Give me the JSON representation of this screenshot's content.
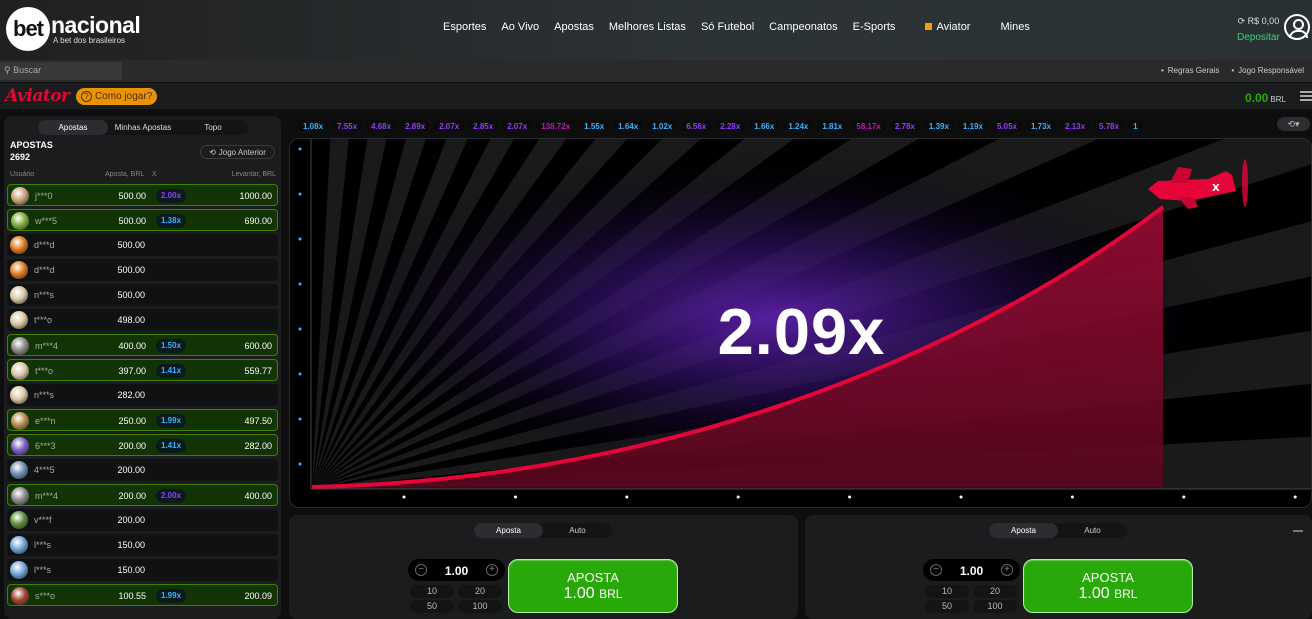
{
  "header": {
    "logo_bet": "bet",
    "logo_name": "nacional",
    "logo_tag": "A bet dos brasileiros",
    "nav": [
      "Esportes",
      "Ao Vivo",
      "Apostas",
      "Melhores Listas",
      "Só Futebol",
      "Campeonatos",
      "E-Sports",
      "Aviator",
      "Mines"
    ],
    "balance": "R$ 0,00",
    "deposit": "Depositar"
  },
  "subbar": {
    "search_placeholder": "Buscar",
    "links": [
      "Regras Gerais",
      "Jogo Responsável"
    ]
  },
  "aviator": {
    "logo": "Aviator",
    "howto": "Como jogar?",
    "balance": "0.00",
    "currency": "BRL"
  },
  "left": {
    "tabs": [
      "Apostas",
      "Minhas Apostas",
      "Topo"
    ],
    "title": "APOSTAS",
    "count": "2692",
    "prev_button": "Jogo Anterior",
    "columns": [
      "Usuário",
      "Aposta, BRL",
      "X",
      "Levantar, BRL"
    ],
    "rows": [
      {
        "user": "j***0",
        "bet": "500.00",
        "mult": "2.00x",
        "mult_color": "#913ef8",
        "cash": "1000.00",
        "win": true,
        "avatar": "#c8a27a"
      },
      {
        "user": "w***5",
        "bet": "500.00",
        "mult": "1.38x",
        "mult_color": "#34b4ff",
        "cash": "690.00",
        "win": true,
        "avatar": "#7fae3e"
      },
      {
        "user": "d***d",
        "bet": "500.00",
        "mult": "",
        "mult_color": "",
        "cash": "",
        "win": false,
        "avatar": "#e07a1f"
      },
      {
        "user": "d***d",
        "bet": "500.00",
        "mult": "",
        "mult_color": "",
        "cash": "",
        "win": false,
        "avatar": "#e07a1f"
      },
      {
        "user": "n***s",
        "bet": "500.00",
        "mult": "",
        "mult_color": "",
        "cash": "",
        "win": false,
        "avatar": "#d9c7a4"
      },
      {
        "user": "t***o",
        "bet": "498.00",
        "mult": "",
        "mult_color": "",
        "cash": "",
        "win": false,
        "avatar": "#d9c7a4"
      },
      {
        "user": "m***4",
        "bet": "400.00",
        "mult": "1.50x",
        "mult_color": "#34b4ff",
        "cash": "600.00",
        "win": true,
        "avatar": "#8a8a8a"
      },
      {
        "user": "t***o",
        "bet": "397.00",
        "mult": "1.41x",
        "mult_color": "#34b4ff",
        "cash": "559.77",
        "win": true,
        "avatar": "#d9c7a4"
      },
      {
        "user": "n***s",
        "bet": "282.00",
        "mult": "",
        "mult_color": "",
        "cash": "",
        "win": false,
        "avatar": "#d9c7a4"
      },
      {
        "user": "e***n",
        "bet": "250.00",
        "mult": "1.99x",
        "mult_color": "#34b4ff",
        "cash": "497.50",
        "win": true,
        "avatar": "#b58a4a"
      },
      {
        "user": "6***3",
        "bet": "200.00",
        "mult": "1.41x",
        "mult_color": "#34b4ff",
        "cash": "282.00",
        "win": true,
        "avatar": "#7b5fc9"
      },
      {
        "user": "4***5",
        "bet": "200.00",
        "mult": "",
        "mult_color": "",
        "cash": "",
        "win": false,
        "avatar": "#6f8fb5"
      },
      {
        "user": "m***4",
        "bet": "200.00",
        "mult": "2.00x",
        "mult_color": "#913ef8",
        "cash": "400.00",
        "win": true,
        "avatar": "#8a8a8a"
      },
      {
        "user": "v***f",
        "bet": "200.00",
        "mult": "",
        "mult_color": "",
        "cash": "",
        "win": false,
        "avatar": "#5f8f3a"
      },
      {
        "user": "l***s",
        "bet": "150.00",
        "mult": "",
        "mult_color": "",
        "cash": "",
        "win": false,
        "avatar": "#6fa5d9"
      },
      {
        "user": "l***s",
        "bet": "150.00",
        "mult": "",
        "mult_color": "",
        "cash": "",
        "win": false,
        "avatar": "#6fa5d9"
      },
      {
        "user": "s***o",
        "bet": "100.55",
        "mult": "1.99x",
        "mult_color": "#34b4ff",
        "cash": "200.09",
        "win": true,
        "avatar": "#a3432f"
      }
    ]
  },
  "history": [
    {
      "v": "1.08x",
      "c": "#34b4ff"
    },
    {
      "v": "7.55x",
      "c": "#913ef8"
    },
    {
      "v": "4.68x",
      "c": "#913ef8"
    },
    {
      "v": "2.89x",
      "c": "#913ef8"
    },
    {
      "v": "2.07x",
      "c": "#913ef8"
    },
    {
      "v": "2.85x",
      "c": "#913ef8"
    },
    {
      "v": "2.07x",
      "c": "#913ef8"
    },
    {
      "v": "138.72x",
      "c": "#c017b4"
    },
    {
      "v": "1.55x",
      "c": "#34b4ff"
    },
    {
      "v": "1.64x",
      "c": "#34b4ff"
    },
    {
      "v": "1.02x",
      "c": "#34b4ff"
    },
    {
      "v": "6.56x",
      "c": "#913ef8"
    },
    {
      "v": "2.28x",
      "c": "#913ef8"
    },
    {
      "v": "1.66x",
      "c": "#34b4ff"
    },
    {
      "v": "1.24x",
      "c": "#34b4ff"
    },
    {
      "v": "1.81x",
      "c": "#34b4ff"
    },
    {
      "v": "58.17x",
      "c": "#c017b4"
    },
    {
      "v": "2.78x",
      "c": "#913ef8"
    },
    {
      "v": "1.39x",
      "c": "#34b4ff"
    },
    {
      "v": "1.19x",
      "c": "#34b4ff"
    },
    {
      "v": "5.05x",
      "c": "#913ef8"
    },
    {
      "v": "1.73x",
      "c": "#34b4ff"
    },
    {
      "v": "2.13x",
      "c": "#913ef8"
    },
    {
      "v": "5.78x",
      "c": "#913ef8"
    },
    {
      "v": "1",
      "c": "#34b4ff"
    }
  ],
  "game": {
    "multiplier": "2.09x"
  },
  "panels": [
    {
      "tabs": [
        "Aposta",
        "Auto"
      ],
      "stake": "1.00",
      "quick": [
        "10",
        "20",
        "50",
        "100"
      ],
      "button": "APOSTA",
      "amount": "1.00",
      "currency": "BRL"
    },
    {
      "tabs": [
        "Aposta",
        "Auto"
      ],
      "stake": "1.00",
      "quick": [
        "10",
        "20",
        "50",
        "100"
      ],
      "button": "APOSTA",
      "amount": "1.00",
      "currency": "BRL"
    }
  ],
  "colors": {
    "accent_red": "#e50539",
    "bet_green": "#28a909",
    "win_bg": "#123405",
    "mult_blue": "#34b4ff",
    "mult_purple": "#913ef8",
    "mult_pink": "#c017b4"
  }
}
